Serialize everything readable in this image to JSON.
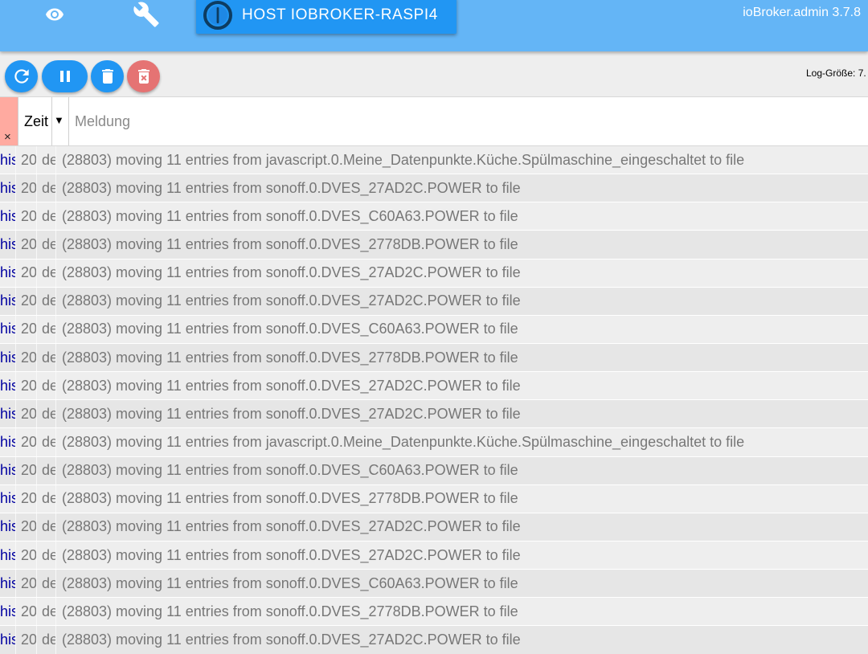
{
  "header": {
    "host_label": "HOST IOBROKER-RASPI4",
    "version": "ioBroker.admin 3.7.8",
    "icons": [
      "eye-icon",
      "wrench-icon",
      "iobroker-logo-icon"
    ]
  },
  "toolbar": {
    "log_size_text": "Log-Größe: 7.",
    "buttons": [
      "refresh-icon",
      "pause-icon",
      "delete-icon",
      "delete-forever-icon"
    ]
  },
  "table": {
    "clear_symbol": "×",
    "time_header": "Zeit",
    "sort_symbol": "▼",
    "message_placeholder": "Meldung"
  },
  "colors": {
    "header": "#64b5f6",
    "primary": "#2196f3",
    "delete_disabled": "#e57373",
    "clear_cell": "#ffaaa0",
    "source_text": "#0000a0"
  },
  "logs": [
    {
      "src": "his",
      "time": "20",
      "sev": "de",
      "msg": "(28803) moving 11 entries from javascript.0.Meine_Datenpunkte.Küche.Spülmaschine_eingeschaltet to file"
    },
    {
      "src": "his",
      "time": "20",
      "sev": "de",
      "msg": "(28803) moving 11 entries from sonoff.0.DVES_27AD2C.POWER to file"
    },
    {
      "src": "his",
      "time": "20",
      "sev": "de",
      "msg": "(28803) moving 11 entries from sonoff.0.DVES_C60A63.POWER to file"
    },
    {
      "src": "his",
      "time": "20",
      "sev": "de",
      "msg": "(28803) moving 11 entries from sonoff.0.DVES_2778DB.POWER to file"
    },
    {
      "src": "his",
      "time": "20",
      "sev": "de",
      "msg": "(28803) moving 11 entries from sonoff.0.DVES_27AD2C.POWER to file"
    },
    {
      "src": "his",
      "time": "20",
      "sev": "de",
      "msg": "(28803) moving 11 entries from sonoff.0.DVES_27AD2C.POWER to file"
    },
    {
      "src": "his",
      "time": "20",
      "sev": "de",
      "msg": "(28803) moving 11 entries from sonoff.0.DVES_C60A63.POWER to file"
    },
    {
      "src": "his",
      "time": "20",
      "sev": "de",
      "msg": "(28803) moving 11 entries from sonoff.0.DVES_2778DB.POWER to file"
    },
    {
      "src": "his",
      "time": "20",
      "sev": "de",
      "msg": "(28803) moving 11 entries from sonoff.0.DVES_27AD2C.POWER to file"
    },
    {
      "src": "his",
      "time": "20",
      "sev": "de",
      "msg": "(28803) moving 11 entries from sonoff.0.DVES_27AD2C.POWER to file"
    },
    {
      "src": "his",
      "time": "20",
      "sev": "de",
      "msg": "(28803) moving 11 entries from javascript.0.Meine_Datenpunkte.Küche.Spülmaschine_eingeschaltet to file"
    },
    {
      "src": "his",
      "time": "20",
      "sev": "de",
      "msg": "(28803) moving 11 entries from sonoff.0.DVES_C60A63.POWER to file"
    },
    {
      "src": "his",
      "time": "20",
      "sev": "de",
      "msg": "(28803) moving 11 entries from sonoff.0.DVES_2778DB.POWER to file"
    },
    {
      "src": "his",
      "time": "20",
      "sev": "de",
      "msg": "(28803) moving 11 entries from sonoff.0.DVES_27AD2C.POWER to file"
    },
    {
      "src": "his",
      "time": "20",
      "sev": "de",
      "msg": "(28803) moving 11 entries from sonoff.0.DVES_27AD2C.POWER to file"
    },
    {
      "src": "his",
      "time": "20",
      "sev": "de",
      "msg": "(28803) moving 11 entries from sonoff.0.DVES_C60A63.POWER to file"
    },
    {
      "src": "his",
      "time": "20",
      "sev": "de",
      "msg": "(28803) moving 11 entries from sonoff.0.DVES_2778DB.POWER to file"
    },
    {
      "src": "his",
      "time": "20",
      "sev": "de",
      "msg": "(28803) moving 11 entries from sonoff.0.DVES_27AD2C.POWER to file"
    }
  ]
}
